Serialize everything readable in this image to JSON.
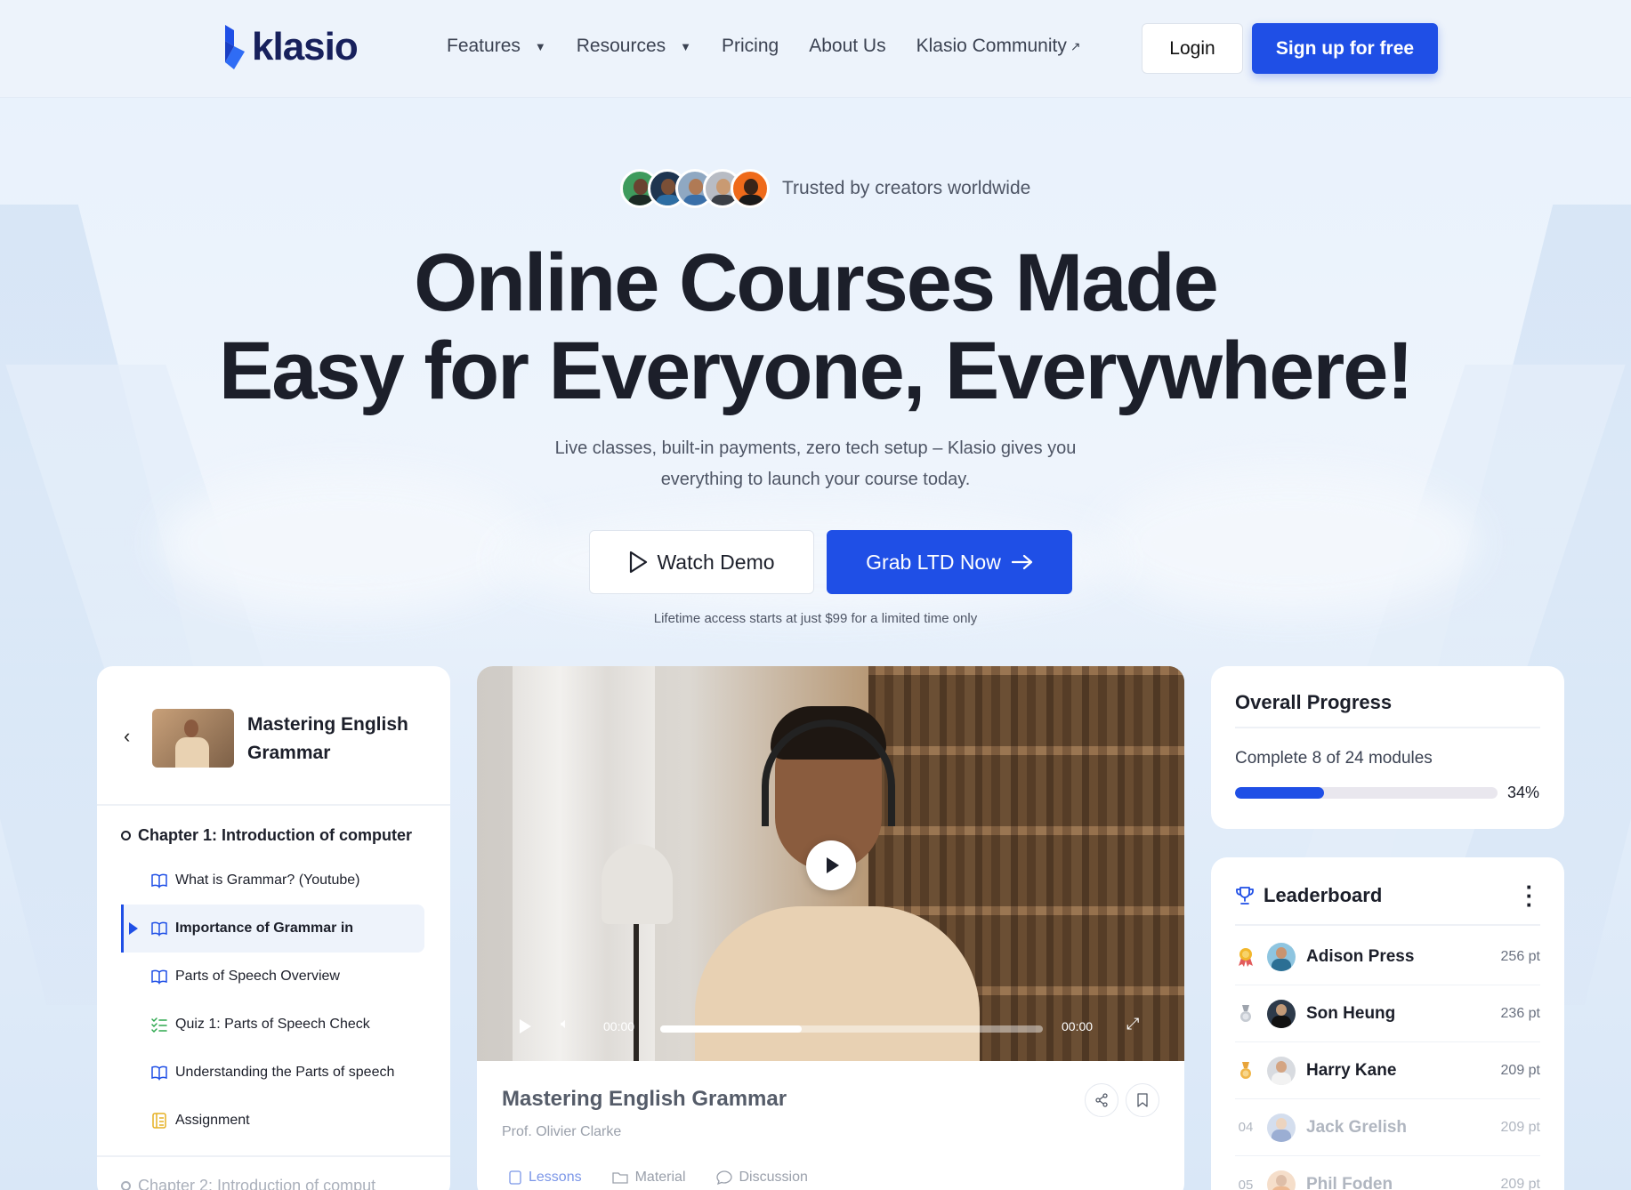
{
  "header": {
    "logo_text": "klasio",
    "nav": [
      {
        "label": "Features",
        "has_dropdown": true
      },
      {
        "label": "Resources",
        "has_dropdown": true
      },
      {
        "label": "Pricing",
        "has_dropdown": false
      },
      {
        "label": "About Us",
        "has_dropdown": false
      },
      {
        "label": "Klasio Community",
        "external": true
      }
    ],
    "login_label": "Login",
    "signup_label": "Sign up for free",
    "accent": "#1f4fe6"
  },
  "hero": {
    "trusted_text": "Trusted by creators worldwide",
    "title_line1": "Online Courses Made",
    "title_line2": "Easy for Everyone, Everywhere!",
    "subtitle_line1": "Live classes, built-in payments, zero tech setup – Klasio gives you",
    "subtitle_line2": "everything to launch your course today.",
    "watch_demo_label": "Watch Demo",
    "grab_label": "Grab LTD Now",
    "note": "Lifetime access starts at just $99 for a limited time only"
  },
  "course": {
    "title": "Mastering English Grammar",
    "chapter1": "Chapter 1: Introduction of computer",
    "lessons": [
      {
        "label": "What is Grammar? (Youtube)",
        "icon": "book-open-icon"
      },
      {
        "label": "Importance of Grammar in",
        "icon": "book-open-icon",
        "active": true
      },
      {
        "label": "Parts of Speech Overview",
        "icon": "book-open-icon"
      },
      {
        "label": "Quiz 1: Parts of Speech Check",
        "icon": "checklist-icon"
      },
      {
        "label": "Understanding the Parts of speech",
        "icon": "book-open-icon"
      },
      {
        "label": "Assignment",
        "icon": "assignment-icon"
      }
    ],
    "chapter2": "Chapter 2: Introduction of comput"
  },
  "video": {
    "time_current": "00:00",
    "time_total": "00:00",
    "progress": 0.37,
    "title": "Mastering English Grammar",
    "author": "Prof. Olivier Clarke",
    "tabs": [
      "Lessons",
      "Material",
      "Discussion"
    ]
  },
  "progress": {
    "title": "Overall Progress",
    "label": "Complete 8 of 24 modules",
    "percent_label": "34%",
    "percent": 0.34
  },
  "leaderboard": {
    "title": "Leaderboard",
    "rows": [
      {
        "rank": "01",
        "name": "Adison Press",
        "points": "256 pt",
        "medal": "gold-ribbon"
      },
      {
        "rank": "02",
        "name": "Son Heung",
        "points": "236 pt",
        "medal": "silver"
      },
      {
        "rank": "03",
        "name": "Harry Kane",
        "points": "209 pt",
        "medal": "bronze"
      },
      {
        "rank": "04",
        "name": "Jack Grelish",
        "points": "209 pt"
      },
      {
        "rank": "05",
        "name": "Phil Foden",
        "points": "209 pt"
      }
    ]
  }
}
